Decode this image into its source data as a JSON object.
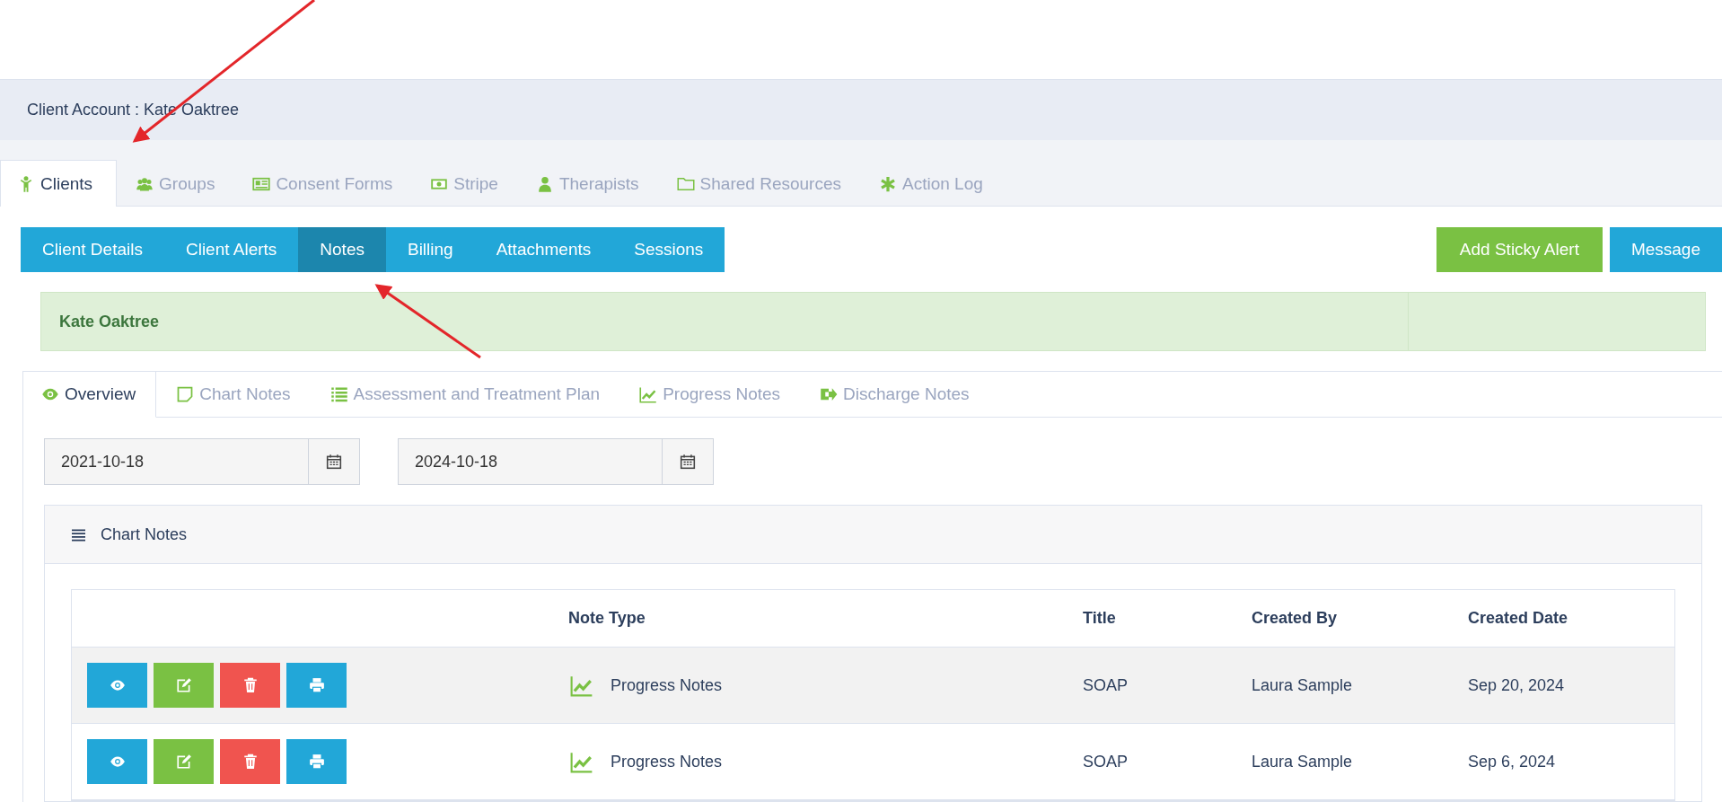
{
  "header": {
    "title": "Client Account : Kate Oaktree"
  },
  "main_tabs": [
    {
      "label": "Clients",
      "selected": true
    },
    {
      "label": "Groups",
      "selected": false
    },
    {
      "label": "Consent Forms",
      "selected": false
    },
    {
      "label": "Stripe",
      "selected": false
    },
    {
      "label": "Therapists",
      "selected": false
    },
    {
      "label": "Shared Resources",
      "selected": false
    },
    {
      "label": "Action Log",
      "selected": false
    }
  ],
  "sub_nav": [
    {
      "label": "Client Details",
      "selected": false
    },
    {
      "label": "Client Alerts",
      "selected": false
    },
    {
      "label": "Notes",
      "selected": true
    },
    {
      "label": "Billing",
      "selected": false
    },
    {
      "label": "Attachments",
      "selected": false
    },
    {
      "label": "Sessions",
      "selected": false
    }
  ],
  "actions": [
    "Add Sticky Alert",
    "Message"
  ],
  "client_banner": {
    "name": "Kate Oaktree"
  },
  "note_tabs": [
    {
      "label": "Overview",
      "selected": true
    },
    {
      "label": "Chart Notes",
      "selected": false
    },
    {
      "label": "Assessment and Treatment Plan",
      "selected": false
    },
    {
      "label": "Progress Notes",
      "selected": false
    },
    {
      "label": "Discharge Notes",
      "selected": false
    }
  ],
  "date_range": {
    "from": "2021-10-18",
    "to": "2024-10-18"
  },
  "chart_notes": {
    "title": "Chart Notes",
    "columns": [
      "Note Type",
      "Title",
      "Created By",
      "Created Date"
    ],
    "rows": [
      {
        "note_type": "Progress Notes",
        "title": "SOAP",
        "created_by": "Laura Sample",
        "created_date": "Sep 20, 2024"
      },
      {
        "note_type": "Progress Notes",
        "title": "SOAP",
        "created_by": "Laura Sample",
        "created_date": "Sep 6, 2024"
      }
    ]
  }
}
